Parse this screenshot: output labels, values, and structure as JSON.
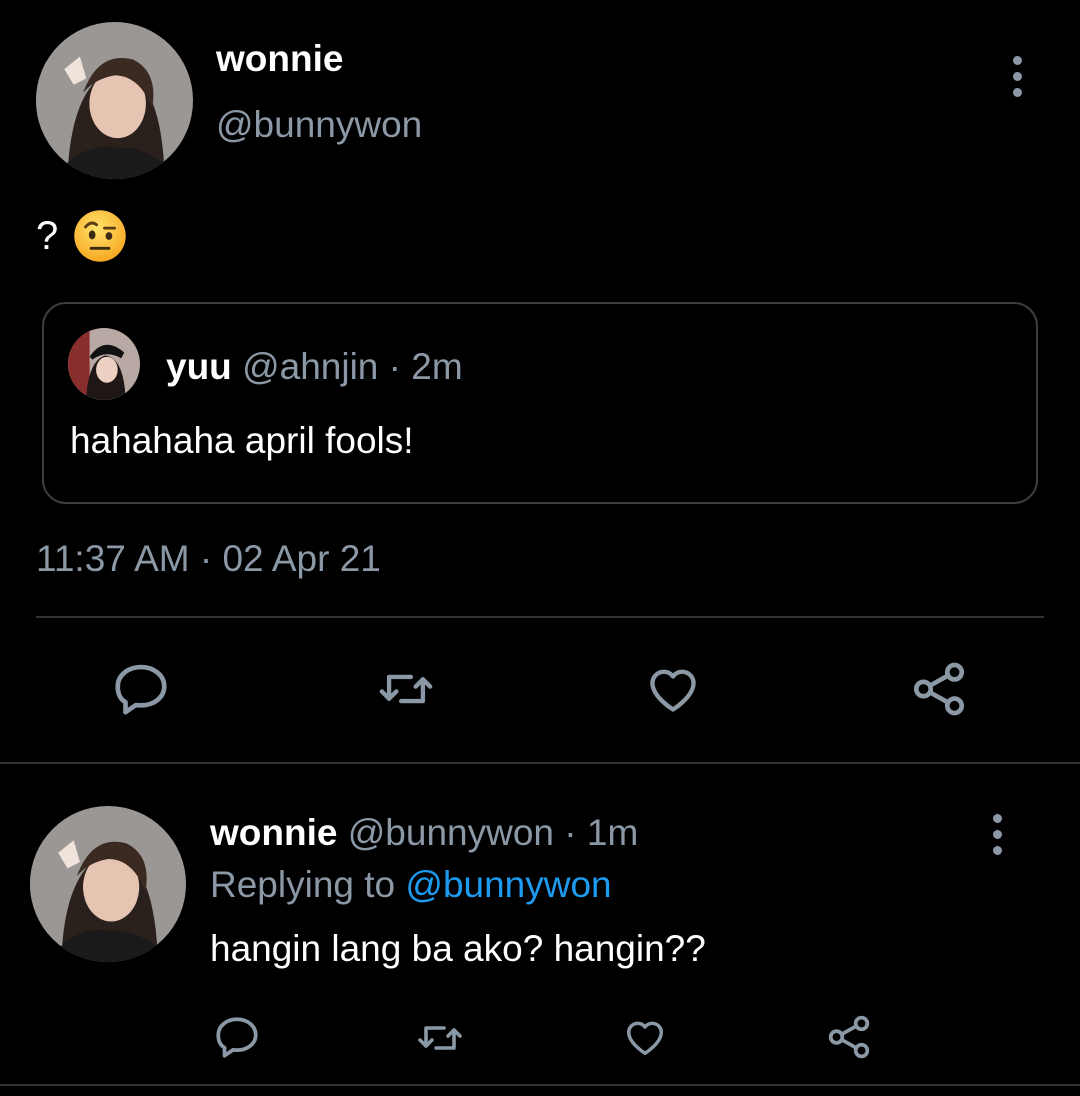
{
  "main_tweet": {
    "author_name": "wonnie",
    "author_handle": "@bunnywon",
    "text": "?",
    "emoji_icon": "face-with-raised-eyebrow-emoji",
    "timestamp": "11:37 AM · 02 Apr 21",
    "quoted": {
      "author_name": "yuu",
      "author_handle": "@ahnjin",
      "separator": "·",
      "time": "2m",
      "text": "hahahaha april fools!"
    },
    "actions": [
      "reply-icon",
      "retweet-icon",
      "like-icon",
      "share-icon"
    ]
  },
  "reply_tweet": {
    "author_name": "wonnie",
    "author_handle": "@bunnywon",
    "separator": "·",
    "time": "1m",
    "replying_prefix": "Replying to",
    "replying_to": "@bunnywon",
    "text": "hangin lang ba ako? hangin??",
    "actions": [
      "reply-icon",
      "retweet-icon",
      "like-icon",
      "share-icon"
    ]
  },
  "colors": {
    "background": "#000000",
    "primary_text": "#ffffff",
    "secondary_text": "#8b98a5",
    "link": "#1d9bf0",
    "border": "#2f3336"
  }
}
